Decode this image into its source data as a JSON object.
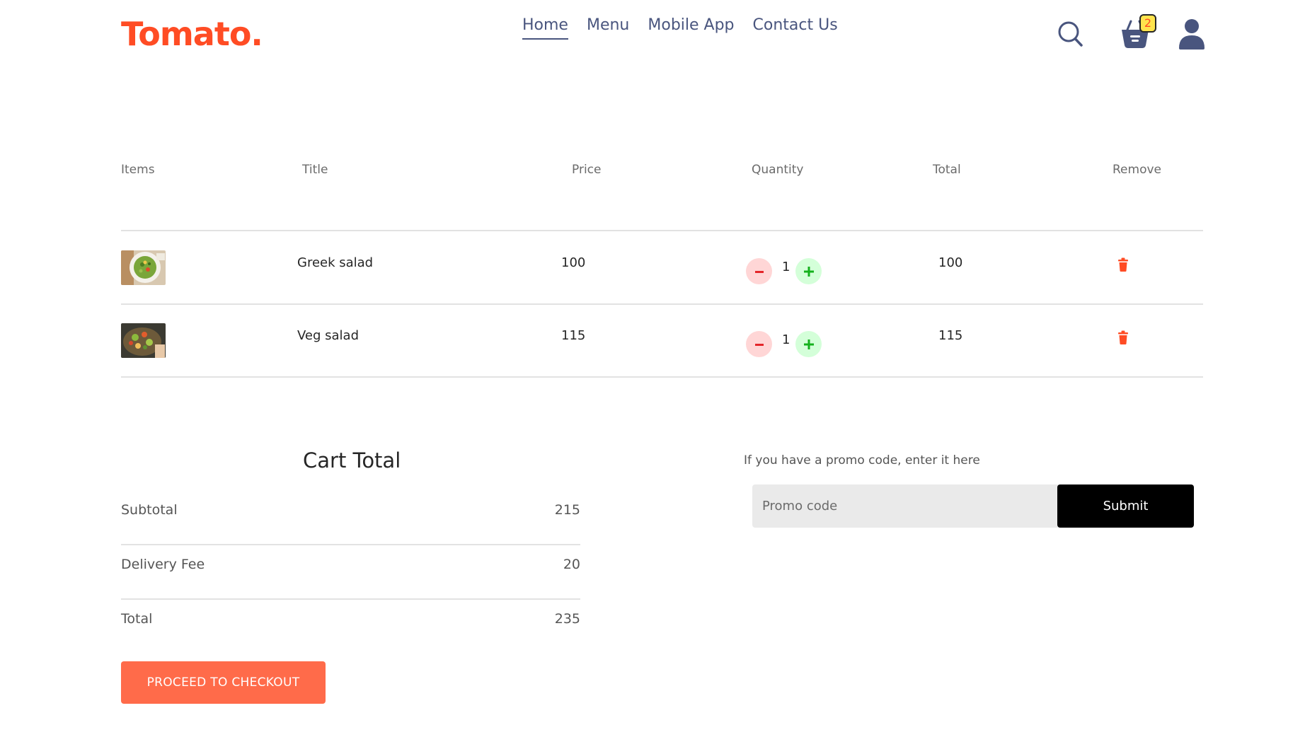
{
  "brand": {
    "logo_text": "Tomato.",
    "accent_color": "#ff4c24"
  },
  "nav": {
    "links": [
      {
        "label": "Home",
        "active": true
      },
      {
        "label": "Menu",
        "active": false
      },
      {
        "label": "Mobile App",
        "active": false
      },
      {
        "label": "Contact Us",
        "active": false
      }
    ],
    "icons": [
      "search-icon",
      "basket-icon",
      "profile-icon"
    ],
    "cart_badge": "2"
  },
  "cart": {
    "headers": [
      "Items",
      "Title",
      "Price",
      "Quantity",
      "Total",
      "Remove"
    ],
    "rows": [
      {
        "image": "greek-salad-thumbnail",
        "title": "Greek salad",
        "price": "100",
        "quantity": "1",
        "total": "100",
        "remove_icon": "trash-icon"
      },
      {
        "image": "veg-salad-thumbnail",
        "title": "Veg salad",
        "price": "115",
        "quantity": "1",
        "total": "115",
        "remove_icon": "trash-icon"
      }
    ]
  },
  "totals": {
    "title": "Cart Total",
    "subtotal_label": "Subtotal",
    "subtotal": "215",
    "delivery_label": "Delivery Fee",
    "delivery": "20",
    "total_label": "Total",
    "total": "235",
    "checkout_label": "PROCEED TO CHECKOUT"
  },
  "promo": {
    "prompt": "If you have a promo code, enter it here",
    "placeholder": "Promo code",
    "value": "",
    "submit_label": "Submit"
  },
  "colors": {
    "nav_text": "#49557e",
    "checkout_bg": "#ff6b4a",
    "minus_bg": "#ffd6d6",
    "plus_bg": "#d4ffd9",
    "badge_bg": "#ffe44d"
  }
}
